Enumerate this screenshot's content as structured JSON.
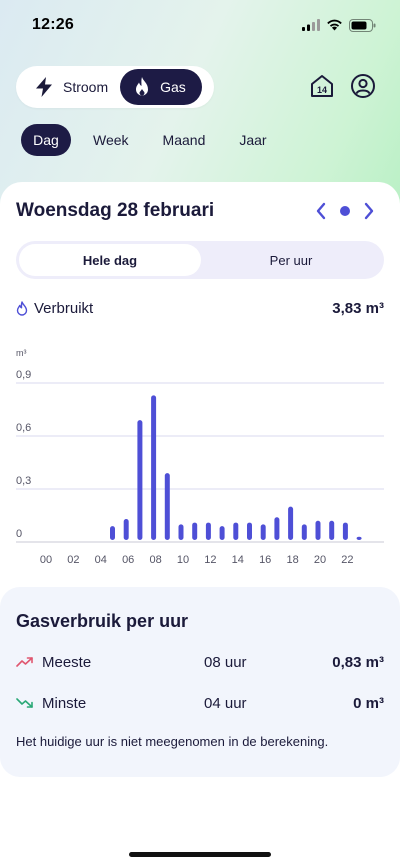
{
  "status": {
    "time": "12:26"
  },
  "energy_toggle": {
    "stroom_label": "Stroom",
    "gas_label": "Gas",
    "active": "gas"
  },
  "header": {
    "calendar_day": "14"
  },
  "period_tabs": [
    {
      "label": "Dag",
      "active": true
    },
    {
      "label": "Week",
      "active": false
    },
    {
      "label": "Maand",
      "active": false
    },
    {
      "label": "Jaar",
      "active": false
    }
  ],
  "date": {
    "title": "Woensdag 28 februari"
  },
  "view_toggle": {
    "whole_day_label": "Hele dag",
    "per_hour_label": "Per uur",
    "active": "whole_day"
  },
  "usage": {
    "label": "Verbruikt",
    "value": "3,83 m³"
  },
  "chart_data": {
    "type": "bar",
    "ylabel": "m³",
    "ylim": [
      0,
      0.9
    ],
    "yticks": [
      "0",
      "0,3",
      "0,6",
      "0,9"
    ],
    "ytick_values": [
      0,
      0.3,
      0.6,
      0.9
    ],
    "xtick_labels": [
      "00",
      "02",
      "04",
      "06",
      "08",
      "10",
      "12",
      "14",
      "16",
      "18",
      "20",
      "22"
    ],
    "categories": [
      "00",
      "01",
      "02",
      "03",
      "04",
      "05",
      "06",
      "07",
      "08",
      "09",
      "10",
      "11",
      "12",
      "13",
      "14",
      "15",
      "16",
      "17",
      "18",
      "19",
      "20",
      "21",
      "22",
      "23"
    ],
    "values": [
      0,
      0,
      0,
      0,
      0,
      0.09,
      0.13,
      0.69,
      0.83,
      0.39,
      0.1,
      0.11,
      0.11,
      0.09,
      0.11,
      0.11,
      0.1,
      0.14,
      0.2,
      0.1,
      0.12,
      0.12,
      0.11,
      0.03
    ],
    "bar_color": "#4e4fd6",
    "grid": true
  },
  "summary": {
    "title": "Gasverbruik per uur",
    "most": {
      "label": "Meeste",
      "hour": "08 uur",
      "value": "0,83 m³"
    },
    "least": {
      "label": "Minste",
      "hour": "04 uur",
      "value": "0 m³"
    },
    "note": "Het huidige uur is niet meegenomen in de berekening."
  },
  "colors": {
    "accent": "#4e4fd6",
    "dark": "#1d1b45",
    "up_trend": "#e0566f",
    "down_trend": "#2aa876"
  }
}
